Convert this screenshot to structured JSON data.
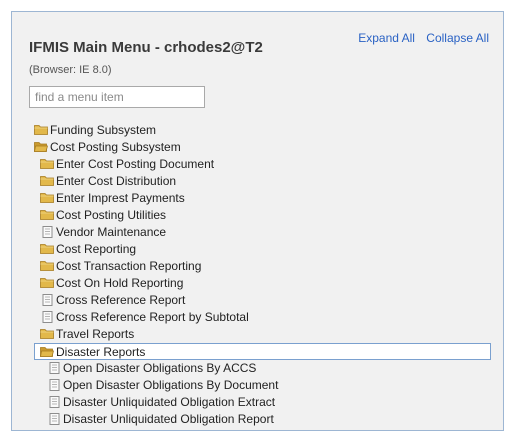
{
  "header": {
    "title": "IFMIS Main Menu - crhodes2@T2",
    "browser": "(Browser: IE 8.0)",
    "expand_all": "Expand All",
    "collapse_all": "Collapse All"
  },
  "search": {
    "placeholder": "find a menu item",
    "value": ""
  },
  "colors": {
    "folder": "#e2b84a",
    "link": "#2a62c4",
    "panel": "#f1f1f1",
    "selected_border": "#7aa0cf"
  },
  "tree": [
    {
      "label": "Funding Subsystem",
      "icon": "folder-closed-icon",
      "level": 0
    },
    {
      "label": "Cost Posting Subsystem",
      "icon": "folder-open-icon",
      "level": 0
    },
    {
      "label": "Enter Cost Posting Document",
      "icon": "folder-closed-icon",
      "level": 1
    },
    {
      "label": "Enter Cost Distribution",
      "icon": "folder-closed-icon",
      "level": 1
    },
    {
      "label": "Enter Imprest Payments",
      "icon": "folder-closed-icon",
      "level": 1
    },
    {
      "label": "Cost Posting Utilities",
      "icon": "folder-closed-icon",
      "level": 1
    },
    {
      "label": "Vendor Maintenance",
      "icon": "page-icon",
      "level": 1
    },
    {
      "label": "Cost Reporting",
      "icon": "folder-closed-icon",
      "level": 1
    },
    {
      "label": "Cost Transaction Reporting",
      "icon": "folder-closed-icon",
      "level": 1
    },
    {
      "label": "Cost On Hold Reporting",
      "icon": "folder-closed-icon",
      "level": 1
    },
    {
      "label": "Cross Reference Report",
      "icon": "page-icon",
      "level": 1
    },
    {
      "label": "Cross Reference Report by Subtotal",
      "icon": "page-icon",
      "level": 1
    },
    {
      "label": "Travel Reports",
      "icon": "folder-closed-icon",
      "level": 1
    },
    {
      "label": "Disaster Reports",
      "icon": "folder-open-icon",
      "level": 1,
      "selected": true
    },
    {
      "label": "Open Disaster Obligations By ACCS",
      "icon": "page-icon",
      "level": 2
    },
    {
      "label": "Open Disaster Obligations By Document",
      "icon": "page-icon",
      "level": 2
    },
    {
      "label": "Disaster Unliquidated Obligation Extract",
      "icon": "page-icon",
      "level": 2
    },
    {
      "label": "Disaster Unliquidated Obligation Report",
      "icon": "page-icon",
      "level": 2
    }
  ]
}
